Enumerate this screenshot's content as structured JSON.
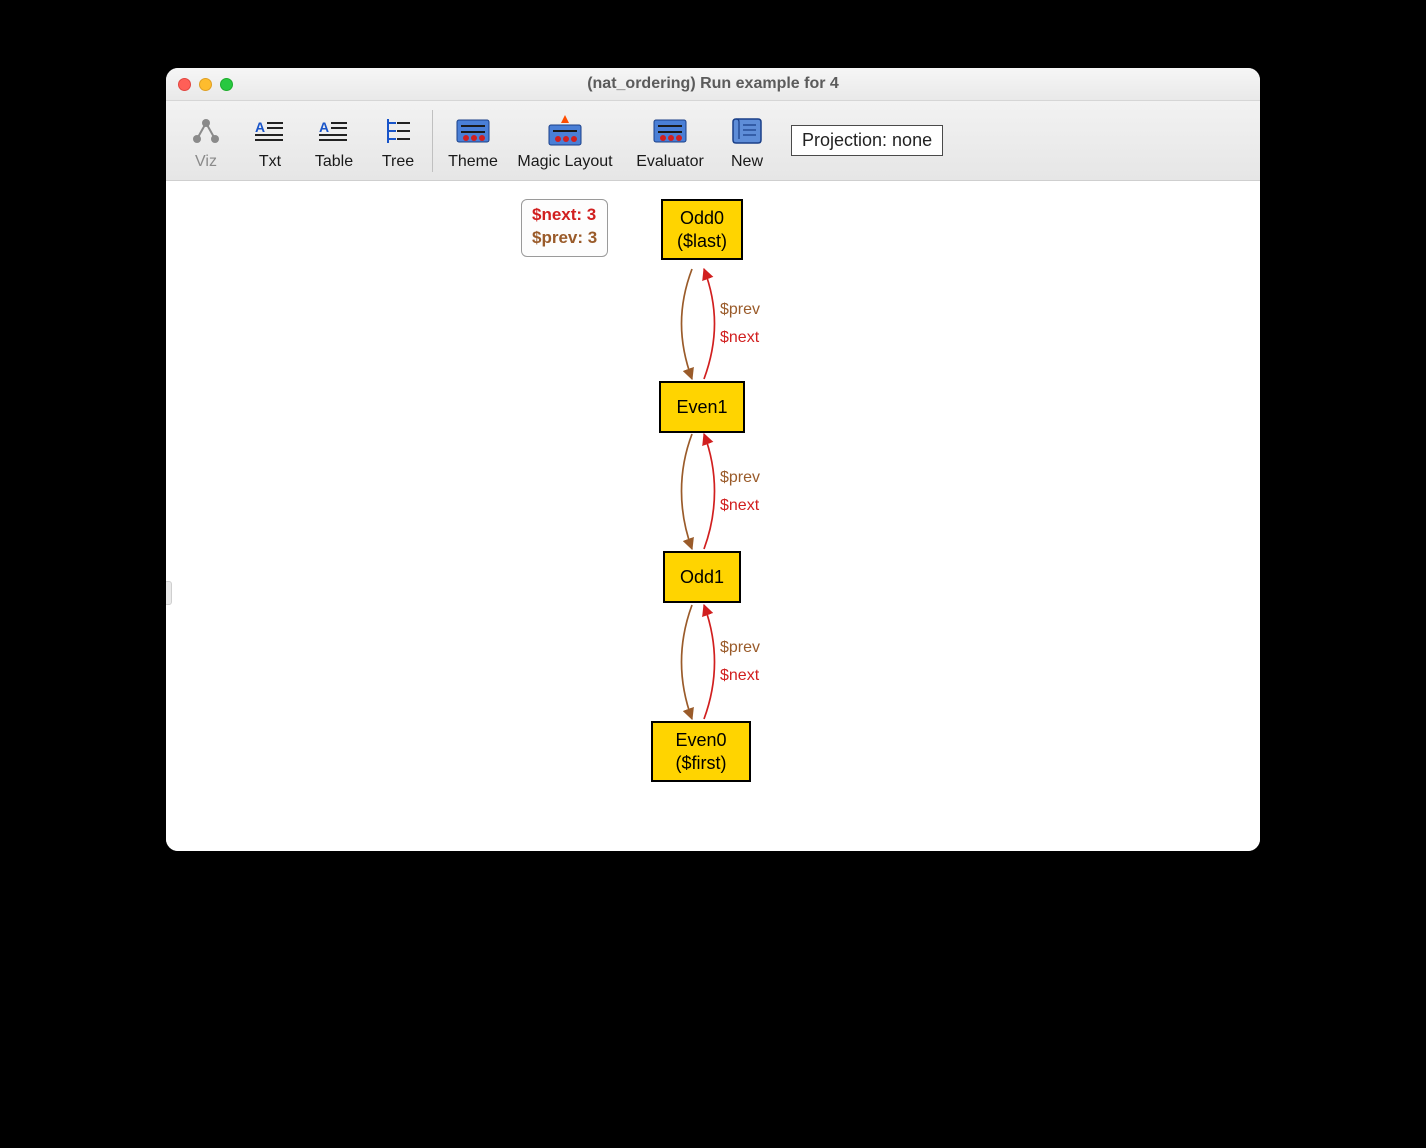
{
  "window": {
    "title": "(nat_ordering) Run example for 4"
  },
  "toolbar": {
    "viz": "Viz",
    "txt": "Txt",
    "table": "Table",
    "tree": "Tree",
    "theme": "Theme",
    "magic_layout": "Magic Layout",
    "evaluator": "Evaluator",
    "new": "New",
    "projection": "Projection: none"
  },
  "infobox": {
    "line1": "$next: 3",
    "line2": "$prev: 3"
  },
  "nodes": {
    "n0": {
      "title": "Odd0",
      "subtitle": "($last)"
    },
    "n1": {
      "title": "Even1",
      "subtitle": ""
    },
    "n2": {
      "title": "Odd1",
      "subtitle": ""
    },
    "n3": {
      "title": "Even0",
      "subtitle": "($first)"
    }
  },
  "edge_labels": {
    "prev": "$prev",
    "next": "$next"
  }
}
